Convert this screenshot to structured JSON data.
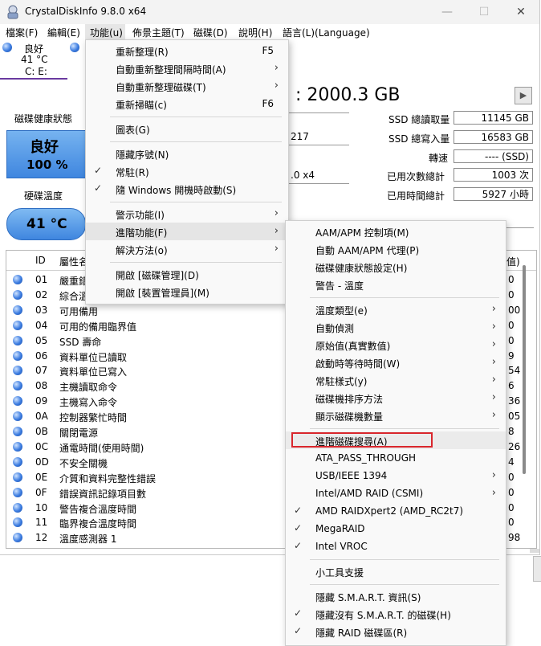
{
  "window": {
    "title": "CrystalDiskInfo 9.8.0 x64",
    "caption_min": "—",
    "caption_max": "☐",
    "caption_close": "✕"
  },
  "menubar": [
    "檔案(F)",
    "編輯(E)",
    "功能(u)",
    "佈景主題(T)",
    "磁碟(D)",
    "說明(H)",
    "語言(L)(Language)"
  ],
  "disk_tab": {
    "status": "良好",
    "temp": "41 °C",
    "drives": "C: E:"
  },
  "health": {
    "label": "磁碟健康狀態",
    "status": "良好",
    "percent": "100 %"
  },
  "temperature": {
    "label": "硬碟溫度",
    "value": "41 °C"
  },
  "disk_capacity": ": 2000.3 GB",
  "partial_left": [
    "217",
    ".0 x4"
  ],
  "stats": [
    {
      "label": "SSD 總讀取量",
      "value": "11145 GB"
    },
    {
      "label": "SSD 總寫入量",
      "value": "16583 GB"
    },
    {
      "label": "轉速",
      "value": "---- (SSD)"
    },
    {
      "label": "已用次數總計",
      "value": "1003 次"
    },
    {
      "label": "已用時間總計",
      "value": "5927 小時"
    }
  ],
  "table": {
    "col_id": "ID",
    "col_name": "屬性名",
    "col_right": "值)",
    "rows": [
      {
        "id": "01",
        "name": "嚴重錯",
        "val": "0"
      },
      {
        "id": "02",
        "name": "綜合溫",
        "val": "0"
      },
      {
        "id": "03",
        "name": "可用備用",
        "val": "00"
      },
      {
        "id": "04",
        "name": "可用的備用臨界值",
        "val": "0"
      },
      {
        "id": "05",
        "name": "SSD 壽命",
        "val": "0"
      },
      {
        "id": "06",
        "name": "資料單位已讀取",
        "val": "9"
      },
      {
        "id": "07",
        "name": "資料單位已寫入",
        "val": "54"
      },
      {
        "id": "08",
        "name": "主機讀取命令",
        "val": "6"
      },
      {
        "id": "09",
        "name": "主機寫入命令",
        "val": "36"
      },
      {
        "id": "0A",
        "name": "控制器繁忙時間",
        "val": "05"
      },
      {
        "id": "0B",
        "name": "關閉電源",
        "val": "8"
      },
      {
        "id": "0C",
        "name": "通電時間(使用時間)",
        "val": "26"
      },
      {
        "id": "0D",
        "name": "不安全關機",
        "val": "4"
      },
      {
        "id": "0E",
        "name": "介質和資料完整性錯誤",
        "val": "0"
      },
      {
        "id": "0F",
        "name": "錯誤資訊記錄項目數",
        "val": "0"
      },
      {
        "id": "10",
        "name": "警告複合溫度時間",
        "val": "0"
      },
      {
        "id": "11",
        "name": "臨界複合溫度時間",
        "val": "0"
      },
      {
        "id": "12",
        "name": "溫度感測器 1",
        "val": "98"
      }
    ]
  },
  "function_menu": {
    "groups": [
      [
        {
          "label": "重新整理(R)",
          "shortcut": "F5"
        },
        {
          "label": "自動重新整理間隔時間(A)",
          "submenu": true
        },
        {
          "label": "自動重新整理磁碟(T)",
          "submenu": true
        },
        {
          "label": "重新掃瞄(c)",
          "shortcut": "F6"
        }
      ],
      [
        {
          "label": "圖表(G)"
        }
      ],
      [
        {
          "label": "隱藏序號(N)"
        },
        {
          "label": "常駐(R)",
          "checked": true
        },
        {
          "label": "隨 Windows 開機時啟動(S)",
          "checked": true
        }
      ],
      [
        {
          "label": "警示功能(I)",
          "submenu": true
        },
        {
          "label": "進階功能(F)",
          "submenu": true,
          "highlight": true
        },
        {
          "label": "解決方法(o)",
          "submenu": true
        }
      ],
      [
        {
          "label": "開啟 [磁碟管理](D)"
        },
        {
          "label": "開啟 [裝置管理員](M)"
        }
      ]
    ]
  },
  "advanced_menu": {
    "groups": [
      [
        {
          "label": "AAM/APM 控制項(M)"
        },
        {
          "label": "自動 AAM/APM 代理(P)"
        },
        {
          "label": "磁碟健康狀態設定(H)"
        },
        {
          "label": "警告 - 溫度"
        }
      ],
      [
        {
          "label": "溫度類型(e)",
          "submenu": true
        },
        {
          "label": "自動偵測",
          "submenu": true
        },
        {
          "label": "原始值(真實數值)",
          "submenu": true
        },
        {
          "label": "啟動時等待時間(W)",
          "submenu": true
        },
        {
          "label": "常駐樣式(y)",
          "submenu": true
        },
        {
          "label": "磁碟機排序方法",
          "submenu": true
        },
        {
          "label": "顯示磁碟機數量",
          "submenu": true
        }
      ],
      [
        {
          "label": "進階磁碟搜尋(A)",
          "boxed": true
        },
        {
          "label": "ATA_PASS_THROUGH"
        },
        {
          "label": "USB/IEEE 1394",
          "submenu": true
        },
        {
          "label": "Intel/AMD RAID (CSMI)",
          "submenu": true
        },
        {
          "label": "AMD RAIDXpert2 (AMD_RC2t7)",
          "checked": true
        },
        {
          "label": "MegaRAID",
          "checked": true
        },
        {
          "label": "Intel VROC",
          "checked": true
        }
      ],
      [
        {
          "label": "小工具支援"
        }
      ],
      [
        {
          "label": "隱藏 S.M.A.R.T. 資訊(S)"
        },
        {
          "label": "隱藏沒有 S.M.A.R.T. 的磁碟(H)",
          "checked": true
        },
        {
          "label": "隱藏 RAID 磁碟區(R)",
          "checked": true
        }
      ]
    ]
  },
  "colors": {
    "accent": "#3a7be0",
    "highlight_box": "#d9262c",
    "health_bg": "#4a8fe0"
  }
}
